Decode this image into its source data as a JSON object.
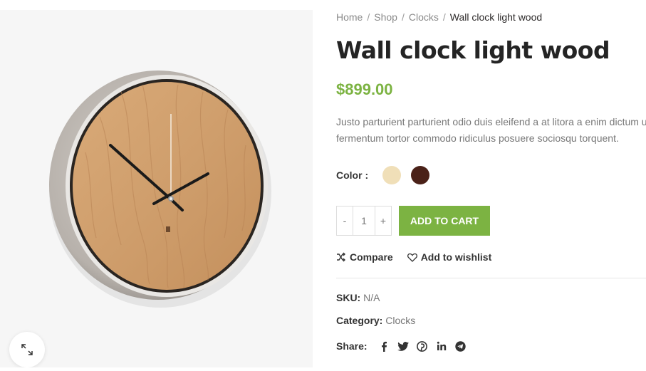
{
  "breadcrumb": {
    "items": [
      "Home",
      "Shop",
      "Clocks"
    ],
    "separator": "/",
    "current": "Wall clock light wood"
  },
  "product": {
    "title": "Wall clock light wood",
    "price": "$899.00",
    "description_lines": [
      "Justo parturient parturient odio duis eleifend a at litora a enim dictum ut",
      "fermentum tortor commodo ridiculus posuere sociosqu torquent."
    ]
  },
  "color": {
    "label": "Color",
    "swatches": [
      {
        "name": "light-wood",
        "hex": "#f0dfb8"
      },
      {
        "name": "dark-wood",
        "hex": "#4a2118"
      }
    ]
  },
  "cart": {
    "minus": "-",
    "quantity": "1",
    "plus": "+",
    "add_label": "Add to cart"
  },
  "actions": {
    "compare": "Compare",
    "wishlist": "Add to wishlist"
  },
  "meta": {
    "sku_label": "SKU:",
    "sku_value": "N/A",
    "category_label": "Category:",
    "category_value": "Clocks",
    "share_label": "Share:"
  },
  "social_icons": [
    "facebook-icon",
    "twitter-icon",
    "pinterest-icon",
    "linkedin-icon",
    "telegram-icon"
  ],
  "colors": {
    "accent": "#7cb342",
    "title": "#242424",
    "muted": "#777777"
  }
}
